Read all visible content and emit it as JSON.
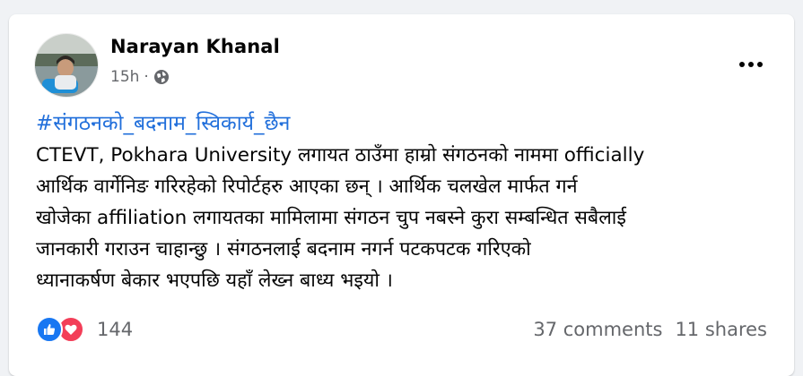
{
  "post": {
    "author": "Narayan Khanal",
    "time": "15h",
    "separator": "·",
    "audience_icon": "globe-icon",
    "more_icon": "more-options-icon",
    "hashtag": "#संगठनको_बदनाम_स्विकार्य_छैन",
    "body_lines": [
      "CTEVT, Pokhara University लगायत ठाउँमा हाम्रो संगठनको नाममा officially",
      "आर्थिक वार्गेनिङ गरिरहेको रिपोर्टहरु आएका छन् । आर्थिक चलखेल मार्फत गर्न",
      "खोजेका affiliation लगायतका मामिलामा संगठन चुप नबस्ने कुरा सम्बन्धित सबैलाई",
      "जानकारी गराउन चाहान्छु । संगठनलाई बदनाम नगर्न पटकपटक गरिएको",
      "ध्यानाकर्षण बेकार भएपछि यहाँ लेख्न बाध्य भइयो ।"
    ]
  },
  "footer": {
    "reaction_icons": [
      "like-icon",
      "love-icon"
    ],
    "reaction_count": "144",
    "comments": "37 comments",
    "shares": "11 shares"
  },
  "colors": {
    "hashtag": "#216fdb",
    "like": "#1877f2",
    "love": "#f33e58",
    "secondary_text": "#65676b",
    "background": "#f0f2f5"
  }
}
